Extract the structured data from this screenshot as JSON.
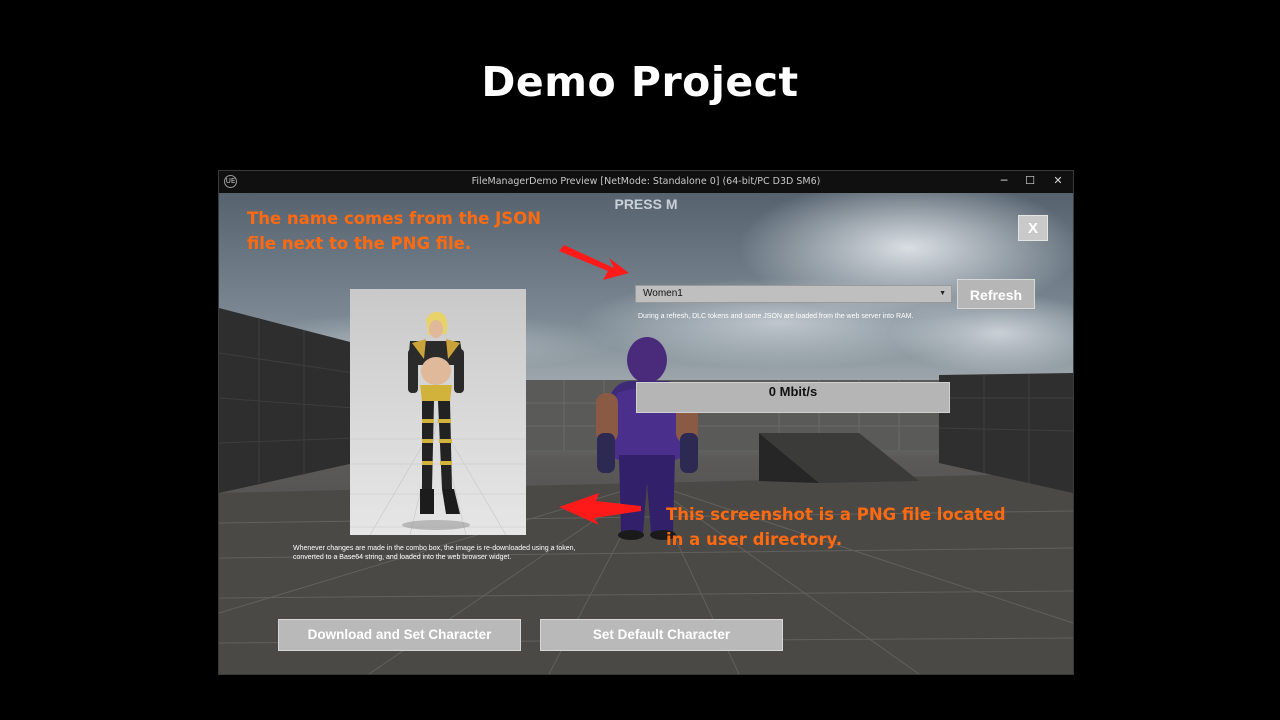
{
  "slide": {
    "title": "Demo Project"
  },
  "window": {
    "title": "FileManagerDemo Preview [NetMode: Standalone 0]  (64-bit/PC D3D SM6)",
    "logo": "UE",
    "controls": {
      "minimize": "─",
      "maximize": "☐",
      "close": "✕"
    }
  },
  "hud": {
    "press_hint": "PRESS M",
    "close_label": "X",
    "combo": {
      "selected": "Women1",
      "arrow": "▼"
    },
    "refresh_label": "Refresh",
    "refresh_note": "During a refresh, DLC tokens and some JSON are loaded from the web server into RAM.",
    "speed": "0 Mbit/s",
    "image_note_line1": "Whenever changes are made in the combo box, the image is re-downloaded using a token,",
    "image_note_line2": "converted to a Base64 string, and loaded into the web browser widget.",
    "download_button": "Download and Set Character",
    "default_button": "Set Default Character"
  },
  "annotations": {
    "name_note_line1": "The name comes from the JSON",
    "name_note_line2": "file next to the PNG file.",
    "screenshot_note_line1": "This screenshot is a PNG file located",
    "screenshot_note_line2": "in a user directory."
  },
  "colors": {
    "annotation": "#ff6a10",
    "arrow": "#ff1a1a",
    "button_bg": "#b9b9b9"
  }
}
